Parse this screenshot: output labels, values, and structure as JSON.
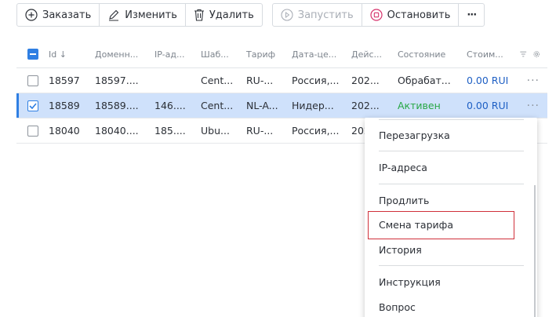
{
  "toolbar": {
    "order_label": "Заказать",
    "edit_label": "Изменить",
    "delete_label": "Удалить",
    "start_label": "Запустить",
    "stop_label": "Остановить",
    "more_label": "···"
  },
  "table": {
    "headers": {
      "id": "Id",
      "domain": "Доменн...",
      "ip": "IP-ад...",
      "template": "Шаб...",
      "tariff": "Тариф",
      "date": "Дата-це...",
      "action": "Дейс...",
      "state": "Состояние",
      "cost": "Стоим..."
    },
    "rows": [
      {
        "id": "18597",
        "domain": "18597....",
        "ip": "",
        "template": "Cent...",
        "tariff": "RU-...",
        "date": "Россия,...",
        "action": "202...",
        "state": "Обрабат...",
        "cost": "0.00 RUI",
        "selected": false
      },
      {
        "id": "18589",
        "domain": "18589....",
        "ip": "146....",
        "template": "Cent...",
        "tariff": "NL-A...",
        "date": "Нидер...",
        "action": "202...",
        "state": "Активен",
        "cost": "0.00 RUI",
        "selected": true
      },
      {
        "id": "18040",
        "domain": "18040....",
        "ip": "185....",
        "template": "Ubu...",
        "tariff": "RU-...",
        "date": "Россия,...",
        "action": "202",
        "state": "",
        "cost": "",
        "selected": false
      }
    ]
  },
  "menu": {
    "items": {
      "reboot": "Перезагрузка",
      "ip": "IP-адреса",
      "extend": "Продлить",
      "change_tariff": "Смена тарифа",
      "history": "История",
      "instruction": "Инструкция",
      "question": "Вопрос"
    }
  },
  "colors": {
    "accent": "#2f7fe3",
    "selected_row": "#cfe1fb",
    "active_state": "#28a745",
    "cost": "#1e5fc4",
    "highlight_border": "#d0303a"
  }
}
